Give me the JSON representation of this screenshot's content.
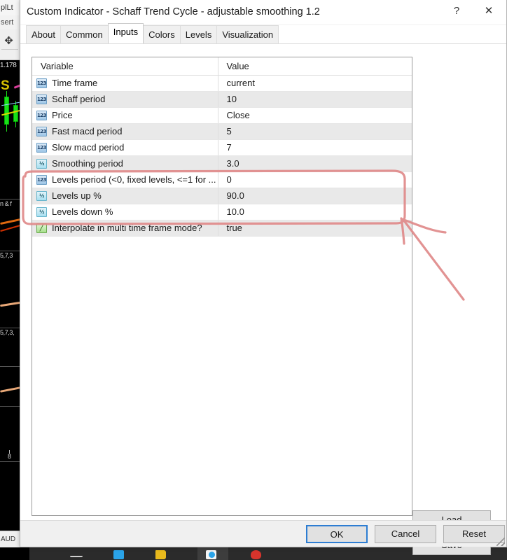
{
  "window": {
    "title": "Custom Indicator - Schaff Trend Cycle - adjustable smoothing 1.2",
    "help_glyph": "?",
    "close_glyph": "✕"
  },
  "tabs": [
    {
      "label": "About",
      "active": false
    },
    {
      "label": "Common",
      "active": false
    },
    {
      "label": "Inputs",
      "active": true
    },
    {
      "label": "Colors",
      "active": false
    },
    {
      "label": "Levels",
      "active": false
    },
    {
      "label": "Visualization",
      "active": false
    }
  ],
  "table": {
    "headers": {
      "variable": "Variable",
      "value": "Value"
    },
    "rows": [
      {
        "icon": "int-type-icon",
        "variable": "Time frame",
        "value": "current"
      },
      {
        "icon": "int-type-icon",
        "variable": "Schaff period",
        "value": "10"
      },
      {
        "icon": "int-type-icon",
        "variable": "Price",
        "value": "Close"
      },
      {
        "icon": "int-type-icon",
        "variable": "Fast macd period",
        "value": "5"
      },
      {
        "icon": "int-type-icon",
        "variable": "Slow macd period",
        "value": "7"
      },
      {
        "icon": "double-type-icon",
        "variable": "Smoothing period",
        "value": "3.0"
      },
      {
        "icon": "int-type-icon",
        "variable": "Levels period (<0, fixed levels, <=1 for ...",
        "value": "0"
      },
      {
        "icon": "double-type-icon",
        "variable": "Levels up %",
        "value": "90.0"
      },
      {
        "icon": "double-type-icon",
        "variable": "Levels down %",
        "value": "10.0"
      },
      {
        "icon": "bool-type-icon",
        "variable": "Interpolate in multi time frame mode?",
        "value": "true"
      }
    ],
    "icon_glyphs": {
      "int": "123",
      "double": "½",
      "bool": "╱"
    }
  },
  "side_buttons": {
    "load": "Load",
    "save": "Save"
  },
  "footer_buttons": {
    "ok": "OK",
    "cancel": "Cancel",
    "reset": "Reset"
  },
  "background_app": {
    "menu_fragment": "plLt",
    "menu_fragment2": "sert",
    "price_label": "1.178",
    "symbol_letter": "S",
    "subpane_labels": [
      "5,7,3",
      "5,7,3,",
      "n & f"
    ],
    "status_fragment": "AUD",
    "axis_fragment": "8"
  },
  "annotation": {
    "ink_color": "#e08a8a",
    "shape": "rounded rectangle around the Levels rows with an arrow pointing right"
  },
  "colors": {
    "accent": "#2d7dd2",
    "row_stripe": "#e9e9e9",
    "dialog_bg": "#ffffff",
    "footer_bg": "#f0f0f0",
    "ink": "#e08a8a"
  }
}
